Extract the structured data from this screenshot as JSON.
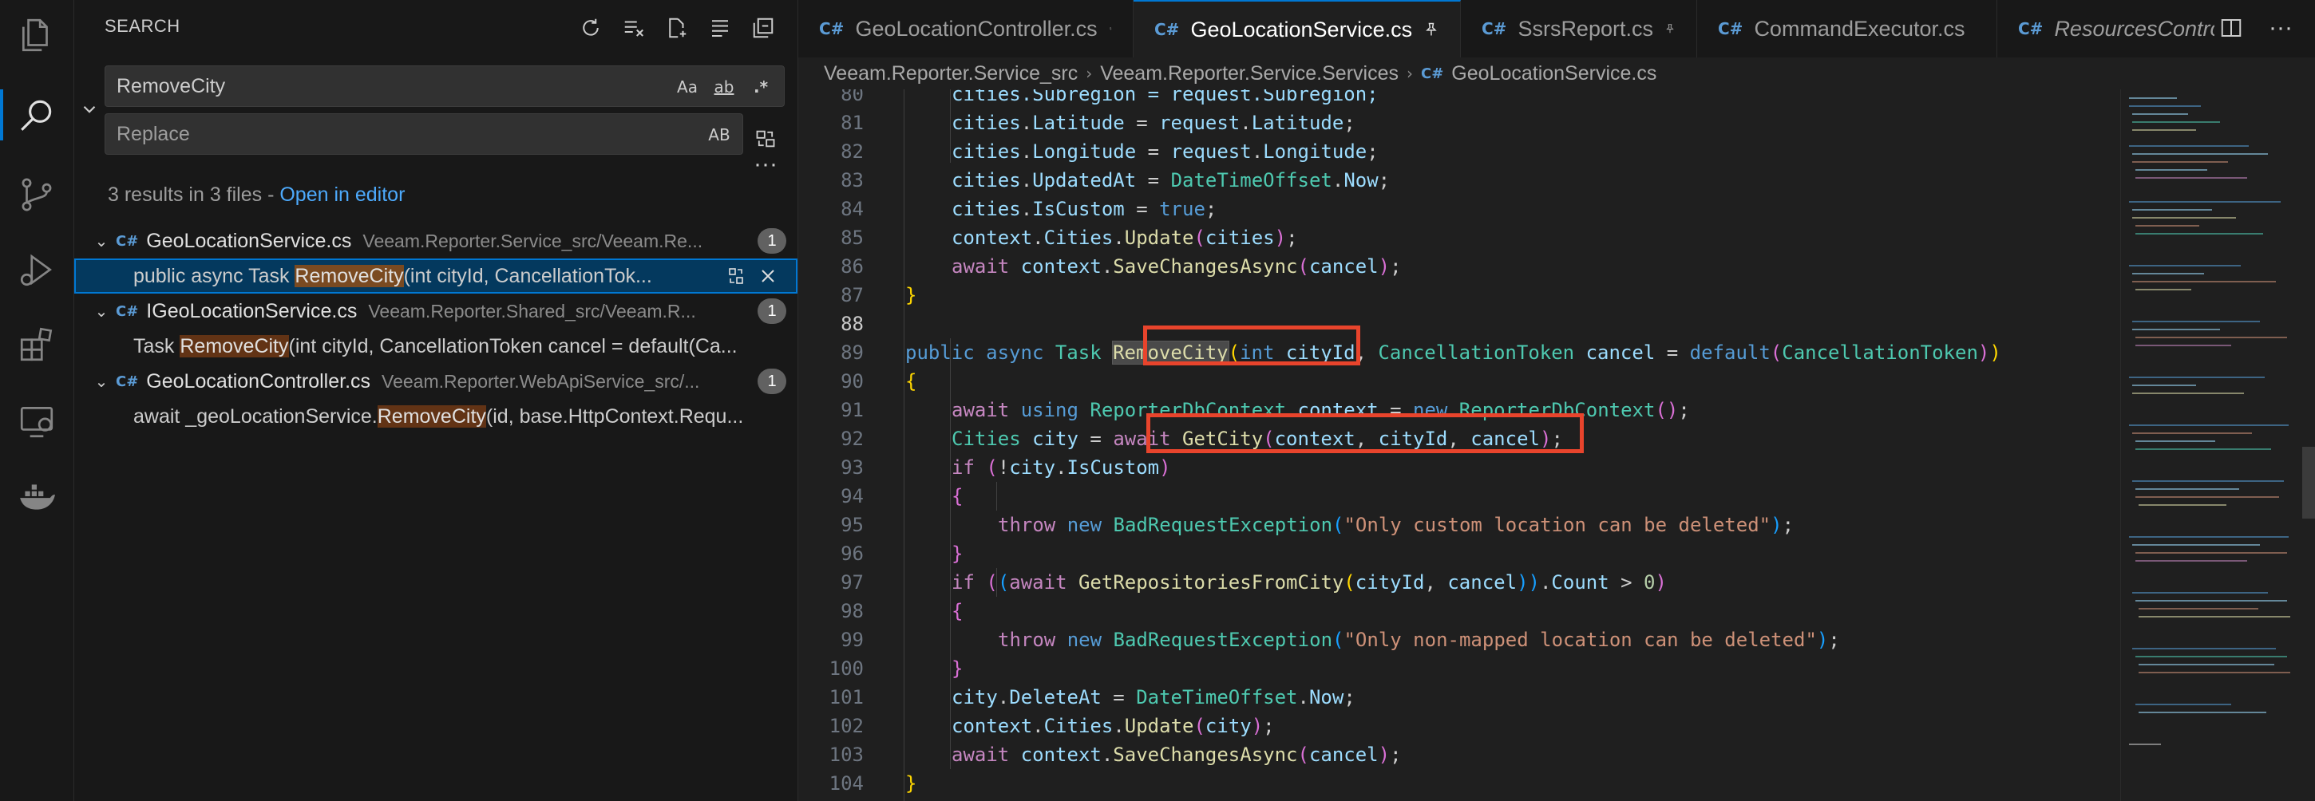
{
  "activity_bar": {
    "items": [
      {
        "name": "explorer-icon"
      },
      {
        "name": "search-icon"
      },
      {
        "name": "source-control-icon"
      },
      {
        "name": "run-debug-icon"
      },
      {
        "name": "extensions-icon"
      },
      {
        "name": "remote-explorer-icon"
      },
      {
        "name": "docker-icon"
      }
    ]
  },
  "search_panel": {
    "title": "SEARCH",
    "search_value": "RemoveCity",
    "replace_placeholder": "Replace",
    "opt_case": "Aa",
    "opt_word": "ab",
    "opt_regex": ".*",
    "opt_preserve_case": "AB",
    "summary_text": "3 results in 3 files - ",
    "open_in_editor": "Open in editor",
    "results": [
      {
        "file": "GeoLocationService.cs",
        "path": "Veeam.Reporter.Service_src/Veeam.Re...",
        "count": "1",
        "match_pre": "public async Task ",
        "match_hit": "RemoveCity",
        "match_post": "(int cityId, CancellationTok..."
      },
      {
        "file": "IGeoLocationService.cs",
        "path": "Veeam.Reporter.Shared_src/Veeam.R...",
        "count": "1",
        "match_pre": "Task ",
        "match_hit": "RemoveCity",
        "match_post": "(int cityId, CancellationToken cancel = default(Ca..."
      },
      {
        "file": "GeoLocationController.cs",
        "path": "Veeam.Reporter.WebApiService_src/...",
        "count": "1",
        "match_pre": "await _geoLocationService.",
        "match_hit": "RemoveCity",
        "match_post": "(id, base.HttpContext.Requ..."
      }
    ]
  },
  "tabs": [
    {
      "label": "GeoLocationController.cs"
    },
    {
      "label": "GeoLocationService.cs"
    },
    {
      "label": "SsrsReport.cs"
    },
    {
      "label": "CommandExecutor.cs"
    },
    {
      "label": "ResourcesControl"
    }
  ],
  "breadcrumb": {
    "part1": "Veeam.Reporter.Service_src",
    "part2": "Veeam.Reporter.Service.Services",
    "part3": "GeoLocationService.cs"
  },
  "editor": {
    "line_numbers": [
      "80",
      "81",
      "82",
      "83",
      "84",
      "85",
      "86",
      "87",
      "88",
      "89",
      "90",
      "91",
      "92",
      "93",
      "94",
      "95",
      "96",
      "97",
      "98",
      "99",
      "100",
      "101",
      "102",
      "103",
      "104"
    ],
    "current_line": "88",
    "line80": "cities.Subregion = request.Subregion;",
    "line81": {
      "a": "cities",
      "b": ".",
      "c": "Latitude",
      "d": " = ",
      "e": "request",
      "f": ".",
      "g": "Latitude",
      "h": ";"
    },
    "line82": {
      "a": "cities",
      "b": ".",
      "c": "Longitude",
      "d": " = ",
      "e": "request",
      "f": ".",
      "g": "Longitude",
      "h": ";"
    },
    "line83": {
      "a": "cities",
      "b": ".",
      "c": "UpdatedAt",
      "d": " = ",
      "e": "DateTimeOffset",
      "f": ".",
      "g": "Now",
      "h": ";"
    },
    "line84": {
      "a": "cities",
      "b": ".",
      "c": "IsCustom",
      "d": " = ",
      "e": "true",
      "h": ";"
    },
    "line85": {
      "a": "context",
      "b": ".",
      "c": "Cities",
      "d": ".",
      "e": "Update",
      "f": "(",
      "g": "cities",
      "h": ")",
      "i": ";"
    },
    "line86": {
      "a": "await",
      "b": " context",
      "c": ".",
      "d": "SaveChangesAsync",
      "e": "(",
      "f": "cancel",
      "g": ")",
      "h": ";"
    },
    "line87": "}",
    "line89": {
      "a": "public",
      "b": " async",
      "c": " Task",
      "d": " ",
      "e": "RemoveCity",
      "f": "(",
      "g": "int",
      "h": " cityId",
      "i": ", ",
      "j": "CancellationToken",
      "k": " cancel",
      "l": " = ",
      "m": "default",
      "n": "(",
      "o": "CancellationToken",
      "p": ")",
      "q": ")"
    },
    "line90": "{",
    "line91": {
      "a": "await",
      "b": " using",
      "c": " ReporterDbContext",
      "d": " context",
      "e": " = ",
      "f": "new",
      "g": " ReporterDbContext",
      "h": "()",
      "i": ";"
    },
    "line92": {
      "a": "Cities",
      "b": " city",
      "c": " = ",
      "d": "await",
      "e": " GetCity",
      "f": "(",
      "g": "context",
      "h": ", ",
      "i": "cityId",
      "j": ", ",
      "k": "cancel",
      "l": ")",
      "m": ";"
    },
    "line93": {
      "a": "if",
      "b": " (",
      "c": "!",
      "d": "city",
      "e": ".",
      "f": "IsCustom",
      "g": ")"
    },
    "line94": "{",
    "line95": {
      "a": "throw",
      "b": " new",
      "c": " BadRequestException",
      "d": "(",
      "e": "\"Only custom location can be deleted\"",
      "f": ")",
      "g": ";"
    },
    "line96": "}",
    "line97": {
      "a": "if",
      "b": " (",
      "c": "(",
      "d": "await",
      "e": " GetRepositoriesFromCity",
      "f": "(",
      "g": "cityId",
      "h": ", ",
      "i": "cancel",
      "j": "))",
      "k": ".",
      "l": "Count",
      "m": " > ",
      "n": "0",
      "o": ")"
    },
    "line98": "{",
    "line99": {
      "a": "throw",
      "b": " new",
      "c": " BadRequestException",
      "d": "(",
      "e": "\"Only non-mapped location can be deleted\"",
      "f": ")",
      "g": ";"
    },
    "line100": "}",
    "line101": {
      "a": "city",
      "b": ".",
      "c": "DeleteAt",
      "d": " = ",
      "e": "DateTimeOffset",
      "f": ".",
      "g": "Now",
      "h": ";"
    },
    "line102": {
      "a": "context",
      "b": ".",
      "c": "Cities",
      "d": ".",
      "e": "Update",
      "f": "(",
      "g": "city",
      "h": ")",
      "i": ";"
    },
    "line103": {
      "a": "await",
      "b": " context",
      "c": ".",
      "d": "SaveChangesAsync",
      "e": "(",
      "f": "cancel",
      "g": ")",
      "h": ";"
    },
    "line104": "}"
  },
  "colors": {
    "accent": "#0078d4",
    "annotation_box": "#e8442c",
    "match_highlight": "#623315"
  }
}
